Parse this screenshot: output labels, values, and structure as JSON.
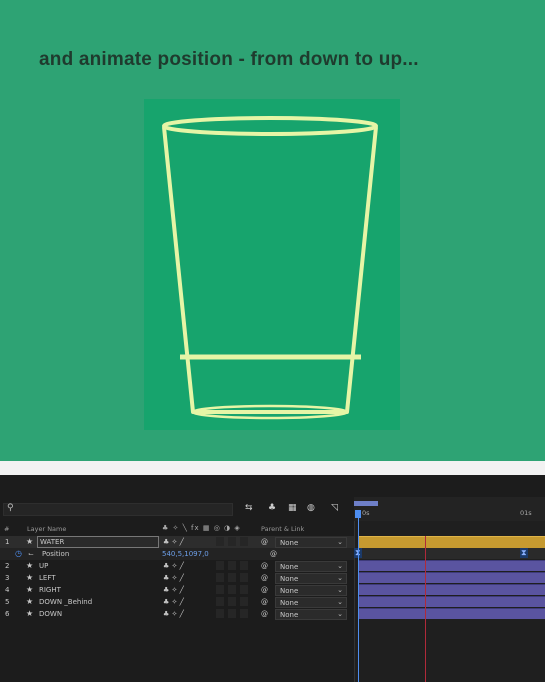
{
  "caption": "and animate position - from down to up...",
  "search": {
    "placeholder": "",
    "icon": "search-icon"
  },
  "columns": {
    "num": "#",
    "layer_name": "Layer Name",
    "parent": "Parent & Link"
  },
  "layers": [
    {
      "num": "1",
      "name": "WATER",
      "parent": "None"
    },
    {
      "num": "",
      "name": "Position",
      "value": "540,5,1097,0"
    },
    {
      "num": "2",
      "name": "UP",
      "parent": "None"
    },
    {
      "num": "3",
      "name": "LEFT",
      "parent": "None"
    },
    {
      "num": "4",
      "name": "RIGHT",
      "parent": "None"
    },
    {
      "num": "5",
      "name": "DOWN _Behind",
      "parent": "None"
    },
    {
      "num": "6",
      "name": "DOWN",
      "parent": "None"
    }
  ],
  "timeline": {
    "ruler_start": "0s",
    "ruler_mark": "01s"
  },
  "colors": {
    "background": "#2ea374",
    "comp": "#17a46d",
    "glass_stroke": "#e6f5a6",
    "label_bar": "#5a54a0",
    "water_bar": "#c69a30"
  }
}
